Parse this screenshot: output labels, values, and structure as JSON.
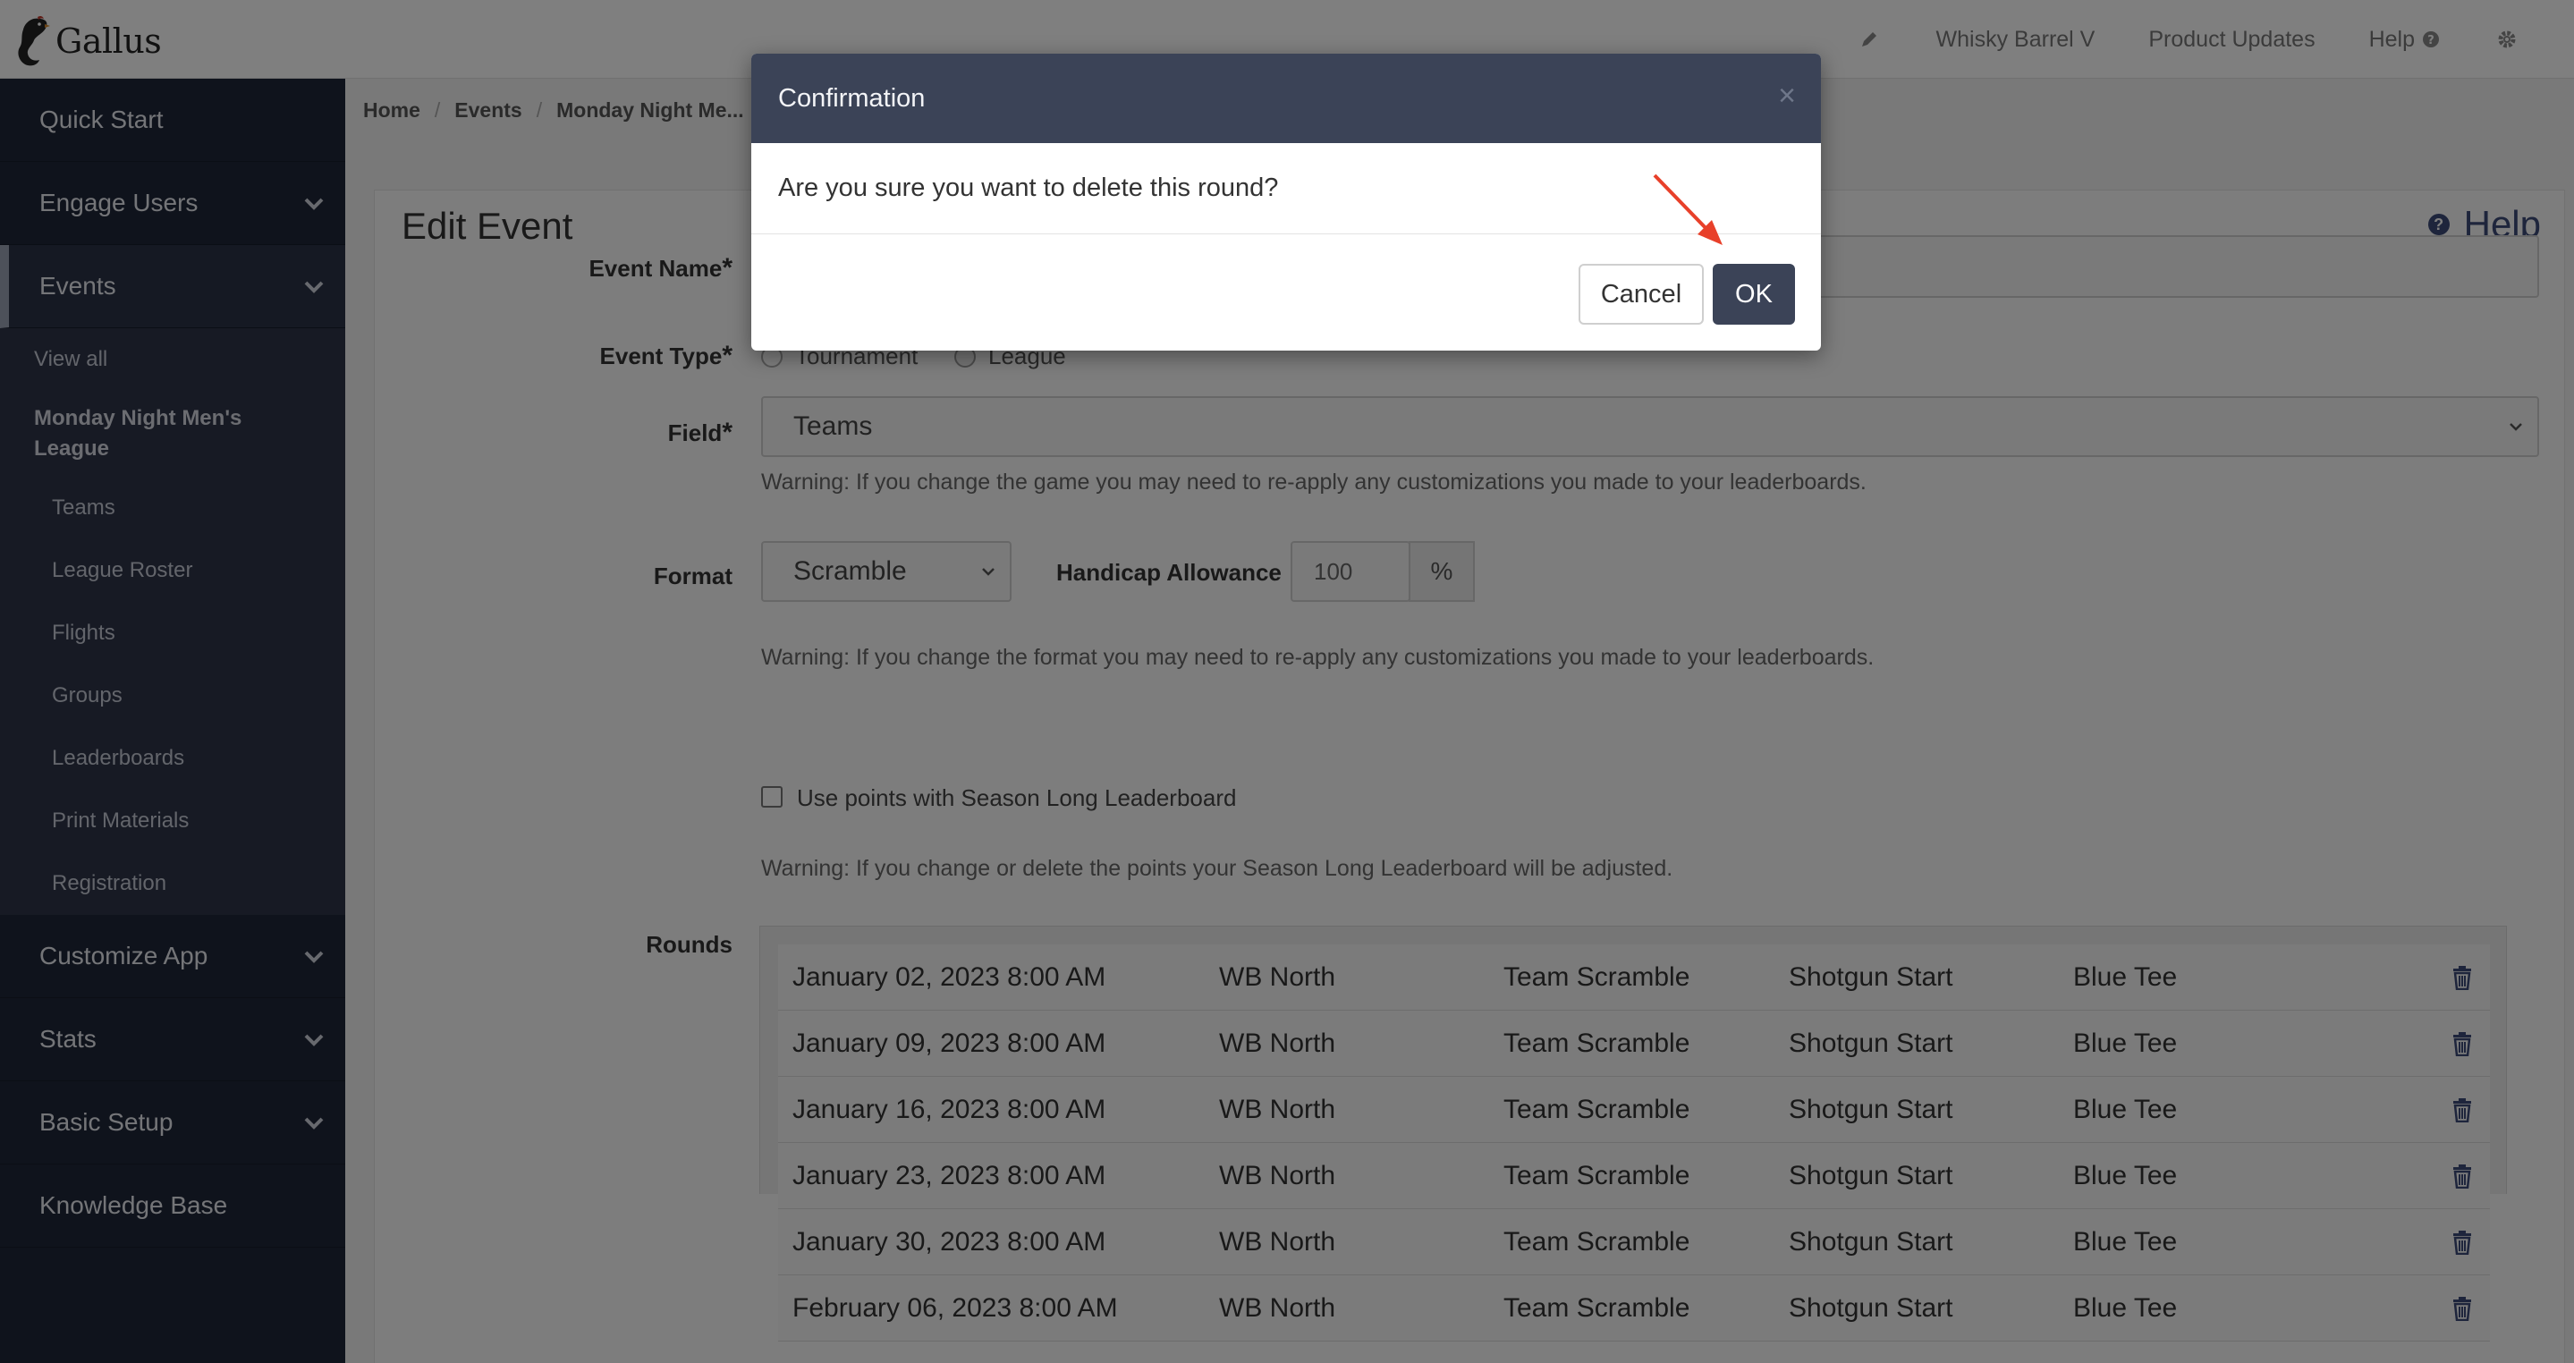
{
  "app": {
    "name": "Gallus"
  },
  "topnav": {
    "org": "Whisky Barrel V",
    "updates": "Product Updates",
    "help": "Help"
  },
  "sidebar": {
    "items": [
      {
        "label": "Quick Start"
      },
      {
        "label": "Engage Users"
      },
      {
        "label": "Events"
      },
      {
        "label": "Customize App"
      },
      {
        "label": "Stats"
      },
      {
        "label": "Basic Setup"
      },
      {
        "label": "Knowledge Base"
      }
    ],
    "events_sub": {
      "view_all": "View all",
      "event_name": "Monday Night Men's League",
      "children": [
        "Teams",
        "League Roster",
        "Flights",
        "Groups",
        "Leaderboards",
        "Print Materials",
        "Registration"
      ]
    }
  },
  "breadcrumb": {
    "home": "Home",
    "events": "Events",
    "current": "Monday Night Me..."
  },
  "page": {
    "title": "Edit Event",
    "help": "Help",
    "labels": {
      "event_name": "Event Name",
      "event_type": "Event Type",
      "field": "Field",
      "format": "Format",
      "rounds": "Rounds",
      "required_mark": "*"
    },
    "event_type": {
      "options": [
        "Tournament",
        "League"
      ],
      "selected": "League"
    },
    "field_value": "Teams",
    "field_warning": "Warning: If you change the game you may need to re-apply any customizations you made to your leaderboards.",
    "format_value": "Scramble",
    "handicap_label": "Handicap Allowance",
    "handicap_value": "100",
    "handicap_unit": "%",
    "format_warning": "Warning: If you change the format you may need to re-apply any customizations you made to your leaderboards.",
    "points_label": "Use points with Season Long Leaderboard",
    "points_checked": false,
    "points_warning": "Warning: If you change or delete the points your Season Long Leaderboard will be adjusted."
  },
  "rounds": [
    {
      "date": "January 02, 2023 8:00 AM",
      "course": "WB North",
      "game": "Team Scramble",
      "start": "Shotgun Start",
      "tee": "Blue Tee"
    },
    {
      "date": "January 09, 2023 8:00 AM",
      "course": "WB North",
      "game": "Team Scramble",
      "start": "Shotgun Start",
      "tee": "Blue Tee"
    },
    {
      "date": "January 16, 2023 8:00 AM",
      "course": "WB North",
      "game": "Team Scramble",
      "start": "Shotgun Start",
      "tee": "Blue Tee"
    },
    {
      "date": "January 23, 2023 8:00 AM",
      "course": "WB North",
      "game": "Team Scramble",
      "start": "Shotgun Start",
      "tee": "Blue Tee"
    },
    {
      "date": "January 30, 2023 8:00 AM",
      "course": "WB North",
      "game": "Team Scramble",
      "start": "Shotgun Start",
      "tee": "Blue Tee"
    },
    {
      "date": "February 06, 2023 8:00 AM",
      "course": "WB North",
      "game": "Team Scramble",
      "start": "Shotgun Start",
      "tee": "Blue Tee"
    }
  ],
  "modal": {
    "title": "Confirmation",
    "message": "Are you sure you want to delete this round?",
    "cancel": "Cancel",
    "ok": "OK",
    "close_glyph": "×"
  },
  "colors": {
    "sidebar_bg": "#1f2638",
    "modal_header": "#3b4357",
    "accent": "#3c4a78",
    "annotation_arrow": "#e8402a"
  },
  "icons": [
    "rooster-logo-icon",
    "pencil-icon",
    "question-circle-icon",
    "gear-icon",
    "chevron-down-icon",
    "trash-icon",
    "close-icon"
  ]
}
